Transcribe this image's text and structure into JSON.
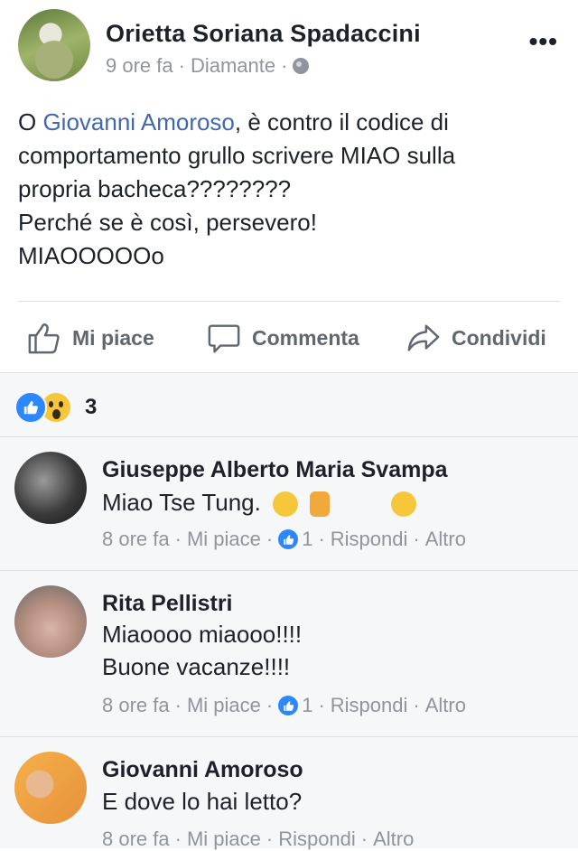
{
  "post": {
    "author": "Orietta Soriana Spadaccini",
    "time": "9 ore fa",
    "location": "Diamante",
    "text_prefix": "O ",
    "mention": "Giovanni Amoroso",
    "text_line1_suffix": ", è contro il codice di",
    "text_line2": "comportamento grullo scrivere MIAO sulla",
    "text_line3": "propria bacheca????????",
    "text_line4": "Perché se è così, persevero!",
    "text_line5": "MIAOOOOOo",
    "more_label": "•••"
  },
  "actions": {
    "like_label": "Mi piace",
    "comment_label": "Commenta",
    "share_label": "Condividi"
  },
  "reactions": {
    "count": "3"
  },
  "comments": [
    {
      "name": "Giuseppe Alberto Maria Svampa",
      "text": "Miao Tse Tung.",
      "time": "8 ore fa",
      "like": "Mi piace",
      "likes": "1",
      "reply": "Rispondi",
      "more": "Altro"
    },
    {
      "name": "Rita Pellistri",
      "text_line1": "Miaoooo miaooo!!!!",
      "text_line2": "Buone vacanze!!!!",
      "time": "8 ore fa",
      "like": "Mi piace",
      "likes": "1",
      "reply": "Rispondi",
      "more": "Altro"
    },
    {
      "name": "Giovanni Amoroso",
      "text": "E dove lo hai letto?",
      "time": "8 ore fa",
      "like": "Mi piace",
      "reply": "Rispondi",
      "more": "Altro"
    }
  ],
  "colors": {
    "accent": "#4267b2",
    "like_blue": "#2d88ff",
    "meta_gray": "#90949c",
    "comments_bg": "#f6f7f9"
  }
}
